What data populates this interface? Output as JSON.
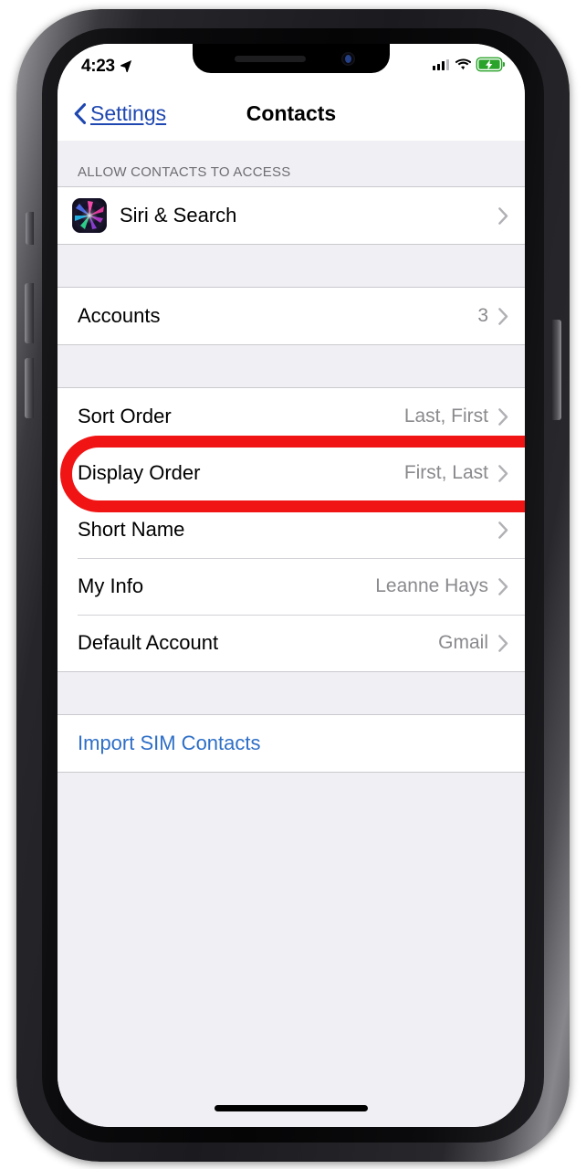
{
  "status_bar": {
    "time": "4:23",
    "location_icon": "location-arrow-icon",
    "signal_icon": "cellular-signal-icon",
    "signal_bars_filled": 3,
    "signal_bars_total": 4,
    "wifi_icon": "wifi-icon",
    "battery_icon": "battery-charging-icon",
    "battery_color": "#2AA32A",
    "charging": true
  },
  "nav_bar": {
    "back_label": "Settings",
    "back_icon": "chevron-left-icon",
    "title": "Contacts",
    "tint_color": "#1E47B0"
  },
  "sections": [
    {
      "header": "ALLOW CONTACTS TO ACCESS",
      "rows": [
        {
          "label": "Siri & Search",
          "value": "",
          "icon": "siri-app-icon",
          "chevron": true,
          "link": false
        }
      ]
    },
    {
      "header": "",
      "rows": [
        {
          "label": "Accounts",
          "value": "3",
          "icon": "",
          "chevron": true,
          "link": false
        }
      ]
    },
    {
      "header": "",
      "rows": [
        {
          "label": "Sort Order",
          "value": "Last, First",
          "icon": "",
          "chevron": true,
          "link": false
        },
        {
          "label": "Display Order",
          "value": "First, Last",
          "icon": "",
          "chevron": true,
          "link": false
        },
        {
          "label": "Short Name",
          "value": "",
          "icon": "",
          "chevron": true,
          "link": false
        },
        {
          "label": "My Info",
          "value": "Leanne Hays",
          "icon": "",
          "chevron": true,
          "link": false
        },
        {
          "label": "Default Account",
          "value": "Gmail",
          "icon": "",
          "chevron": true,
          "link": false
        }
      ]
    },
    {
      "header": "",
      "rows": [
        {
          "label": "Import SIM Contacts",
          "value": "",
          "icon": "",
          "chevron": false,
          "link": true
        }
      ]
    }
  ],
  "annotation": {
    "target_row": "Display Order",
    "shape": "ellipse",
    "color": "#F01414"
  },
  "device": {
    "home_indicator": "home-indicator-bar",
    "notch_camera": "front-camera-icon",
    "notch_speaker": "earpiece-speaker-icon"
  }
}
